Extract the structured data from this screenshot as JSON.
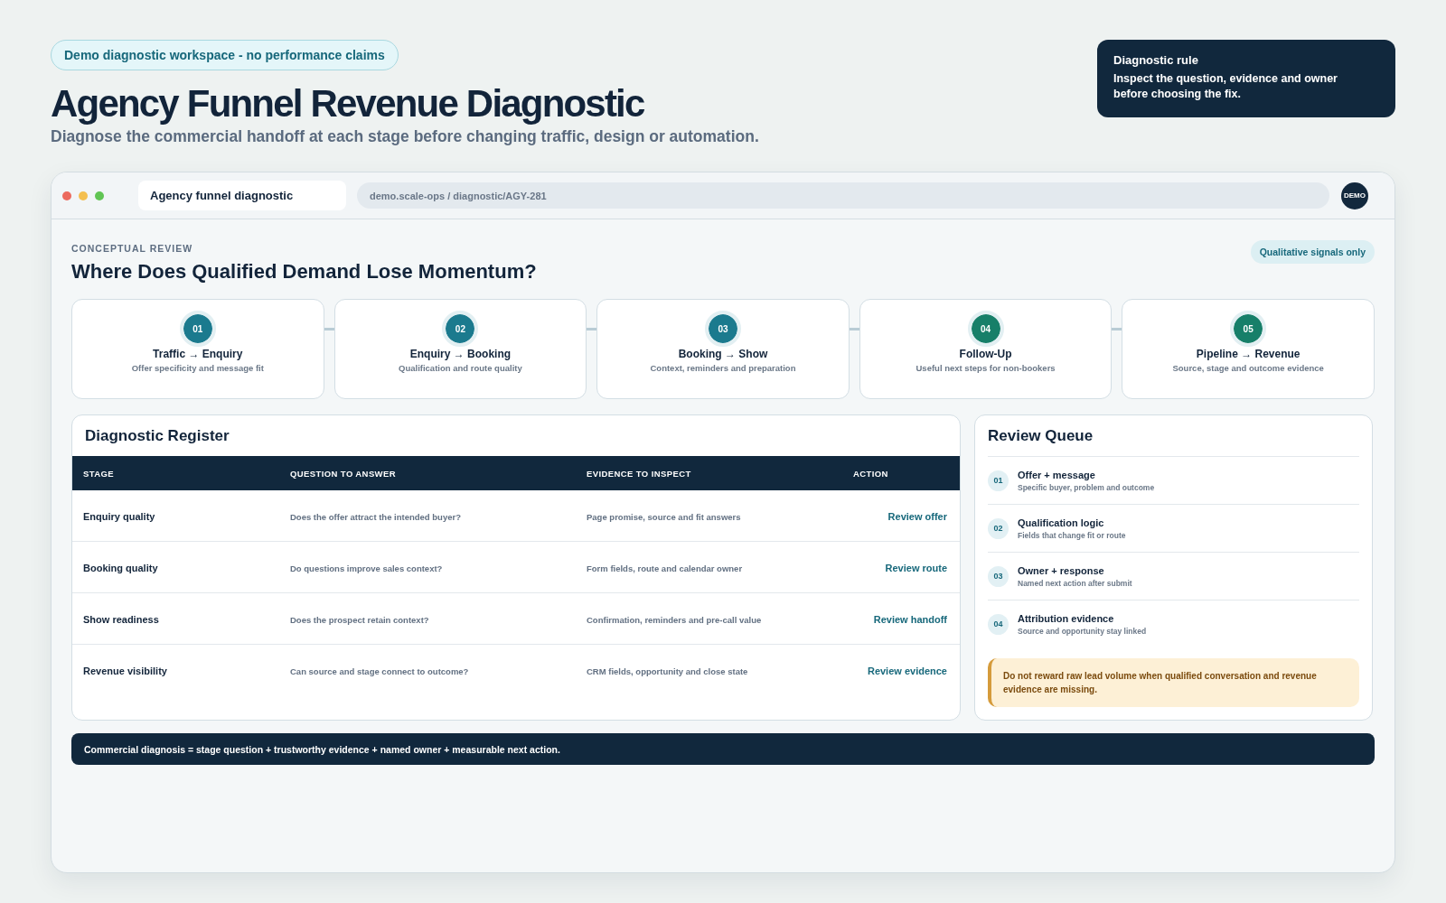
{
  "header": {
    "badge": "Demo diagnostic workspace - no performance claims",
    "title": "Agency Funnel Revenue Diagnostic",
    "subtitle": "Diagnose the commercial handoff at each stage before changing traffic, design or automation."
  },
  "rule_card": {
    "title": "Diagnostic rule",
    "text": "Inspect the question, evidence and owner before choosing the fix."
  },
  "browser": {
    "tab": "Agency funnel diagnostic",
    "address": "demo.scale-ops / diagnostic/AGY-281",
    "avatar": "DEMO"
  },
  "review": {
    "eyebrow": "CONCEPTUAL REVIEW",
    "heading": "Where Does Qualified Demand Lose Momentum?",
    "tag": "Qualitative signals only"
  },
  "stages": [
    {
      "number": "01",
      "title": "Traffic → Enquiry",
      "subtitle": "Offer specificity and message fit",
      "color": "#1b7a8e"
    },
    {
      "number": "02",
      "title": "Enquiry → Booking",
      "subtitle": "Qualification and route quality",
      "color": "#1b7a8e"
    },
    {
      "number": "03",
      "title": "Booking → Show",
      "subtitle": "Context, reminders and preparation",
      "color": "#1b7a8e"
    },
    {
      "number": "04",
      "title": "Follow-Up",
      "subtitle": "Useful next steps for non-bookers",
      "color": "#177f69"
    },
    {
      "number": "05",
      "title": "Pipeline → Revenue",
      "subtitle": "Source, stage and outcome evidence",
      "color": "#177f69"
    }
  ],
  "register": {
    "title": "Diagnostic Register",
    "columns": [
      "STAGE",
      "QUESTION TO ANSWER",
      "EVIDENCE TO INSPECT",
      "ACTION"
    ],
    "rows": [
      {
        "stage": "Enquiry quality",
        "question": "Does the offer attract the intended buyer?",
        "evidence": "Page promise, source and fit answers",
        "action": "Review offer"
      },
      {
        "stage": "Booking quality",
        "question": "Do questions improve sales context?",
        "evidence": "Form fields, route and calendar owner",
        "action": "Review route"
      },
      {
        "stage": "Show readiness",
        "question": "Does the prospect retain context?",
        "evidence": "Confirmation, reminders and pre-call value",
        "action": "Review handoff"
      },
      {
        "stage": "Revenue visibility",
        "question": "Can source and stage connect to outcome?",
        "evidence": "CRM fields, opportunity and close state",
        "action": "Review evidence"
      }
    ]
  },
  "queue": {
    "title": "Review Queue",
    "items": [
      {
        "number": "01",
        "title": "Offer + message",
        "subtitle": "Specific buyer, problem and outcome"
      },
      {
        "number": "02",
        "title": "Qualification logic",
        "subtitle": "Fields that change fit or route"
      },
      {
        "number": "03",
        "title": "Owner + response",
        "subtitle": "Named next action after submit"
      },
      {
        "number": "04",
        "title": "Attribution evidence",
        "subtitle": "Source and opportunity stay linked"
      }
    ],
    "warning": "Do not reward raw lead volume when qualified conversation and revenue evidence are missing."
  },
  "footer_note": "Commercial diagnosis = stage question + trustworthy evidence + named owner + measurable next action."
}
